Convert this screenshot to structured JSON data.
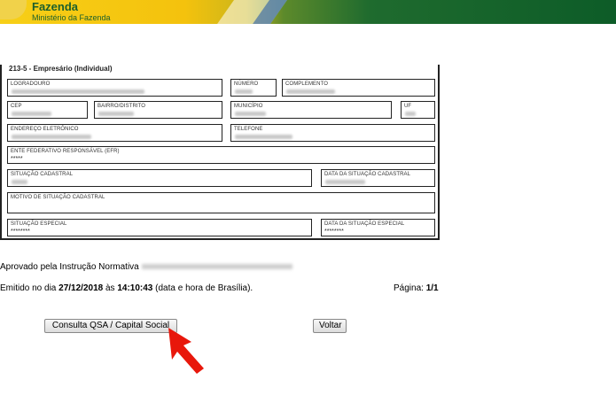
{
  "header": {
    "title": "Fazenda",
    "subtitle": "Ministério da Fazenda"
  },
  "form": {
    "section_title": "213-5 - Empresário (Individual)",
    "fields": {
      "logradouro": {
        "label": "LOGRADOURO"
      },
      "numero": {
        "label": "NÚMERO"
      },
      "complemento": {
        "label": "COMPLEMENTO"
      },
      "cep": {
        "label": "CEP"
      },
      "bairro": {
        "label": "BAIRRO/DISTRITO"
      },
      "municipio": {
        "label": "MUNICÍPIO"
      },
      "uf": {
        "label": "UF"
      },
      "email": {
        "label": "ENDEREÇO ELETRÔNICO"
      },
      "telefone": {
        "label": "TELEFONE"
      },
      "efr": {
        "label": "ENTE FEDERATIVO RESPONSÁVEL (EFR)",
        "value": "*****"
      },
      "situacao": {
        "label": "SITUAÇÃO CADASTRAL"
      },
      "data_situacao": {
        "label": "DATA DA SITUAÇÃO CADASTRAL"
      },
      "motivo": {
        "label": "MOTIVO DE SITUAÇÃO CADASTRAL"
      },
      "situacao_especial": {
        "label": "SITUAÇÃO ESPECIAL",
        "value": "********"
      },
      "data_situacao_especial": {
        "label": "DATA DA SITUAÇÃO ESPECIAL",
        "value": "********"
      }
    }
  },
  "footer": {
    "approved_text": "Aprovado pela Instrução Normativa",
    "issued_prefix": "Emitido no dia ",
    "issued_date": "27/12/2018",
    "issued_mid": " às ",
    "issued_time": "14:10:43",
    "issued_suffix": " (data e hora de Brasília).",
    "page_label": "Página: ",
    "page_value": "1/1"
  },
  "buttons": {
    "qsa": "Consulta QSA / Capital Social",
    "back": "Voltar"
  },
  "colors": {
    "banner_green": "#1b5f2c",
    "banner_yellow": "#f4c20d",
    "arrow_red": "#e8170b"
  },
  "icons": {
    "pointer": "red-arrow-icon"
  }
}
